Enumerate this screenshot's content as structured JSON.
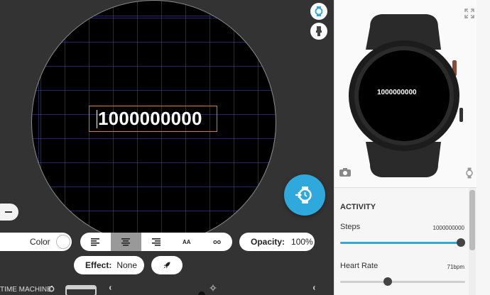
{
  "canvas": {
    "selected_text": "1000000000"
  },
  "toolbar": {
    "color_label": "Color",
    "alignment_buttons": [
      "align-left",
      "align-center",
      "align-right"
    ],
    "font_size_label": "AA",
    "link_label": "oo",
    "opacity_label": "Opacity:",
    "opacity_value": "100%",
    "effect_label": "Effect:",
    "effect_value": "None"
  },
  "time_machine": {
    "label": "TIME MACHINE"
  },
  "preview": {
    "watch_time_text": "1000000000"
  },
  "activity": {
    "section_title": "ACTIVITY",
    "steps": {
      "label": "Steps",
      "value": "1000000000",
      "level": 1.0
    },
    "heart_rate": {
      "label": "Heart Rate",
      "value": "71bpm",
      "level": 0.37
    }
  },
  "colors": {
    "accent": "#2fa8dc",
    "selection": "#e07b1a",
    "grid": "#4646aa"
  }
}
